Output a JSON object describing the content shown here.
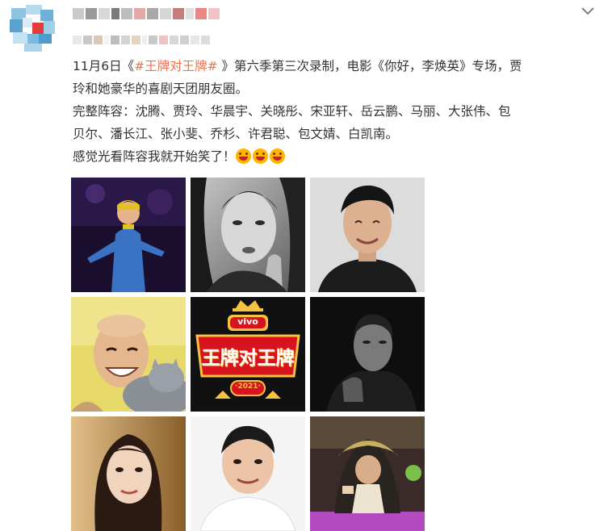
{
  "post": {
    "author_name": "",
    "line1_prefix": "11月6日《",
    "line1_hashtag": "#王牌对王牌#",
    "line1_suffix": " 》第六季第三次录制，电影《你好，李焕英》专场，贾",
    "line2": "玲和她豪华的喜剧天团朋友圈。",
    "line3": "完整阵容：沈腾、贾玲、华晨宇、关晓彤、宋亚轩、岳云鹏、马丽、大张伟、包",
    "line4": "贝尔、潘长江、张小斐、乔杉、许君聪、包文婧、白凯南。",
    "line5": "感觉光看阵容我就开始笑了！"
  },
  "logo": {
    "brand": "vivo",
    "show_title": "王牌对王牌",
    "year": "·2021·"
  },
  "icons": {
    "more": "chevron-down-icon",
    "emoji": "laughing-emoji-icon"
  },
  "colors": {
    "hashtag": "#eb7350",
    "text": "#333333",
    "logo_red": "#d7141e",
    "logo_gold": "#f5c242"
  }
}
